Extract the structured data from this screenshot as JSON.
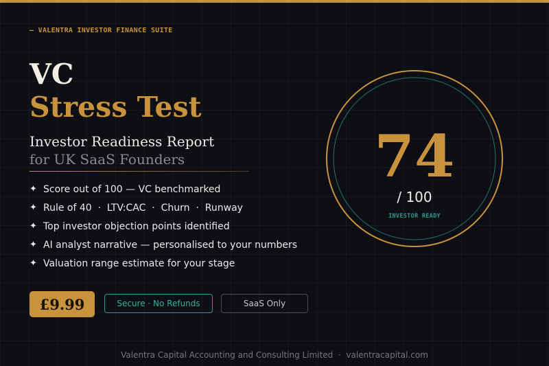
{
  "brand": {
    "eyebrow": "— VALENTRA INVESTOR FINANCE SUITE"
  },
  "hero": {
    "title_line1": "VC",
    "title_line2": "Stress Test",
    "subtitle_line1": "Investor Readiness Report",
    "subtitle_line2": "for UK SaaS Founders"
  },
  "features": [
    {
      "icon": "sparkle-icon",
      "text": "Score out of 100 — VC benchmarked"
    },
    {
      "icon": "sparkle-icon",
      "text": "Rule of 40  ·  LTV:CAC  ·  Churn  ·  Runway"
    },
    {
      "icon": "sparkle-icon",
      "text": "Top investor objection points identified"
    },
    {
      "icon": "sparkle-icon",
      "text": "AI analyst narrative — personalised to your numbers"
    },
    {
      "icon": "sparkle-icon",
      "text": "Valuation range estimate for your stage"
    }
  ],
  "cta": {
    "price": "£9.99",
    "secure_label": "Secure · No Refunds",
    "saas_label": "SaaS Only"
  },
  "score": {
    "value": "74",
    "out_of": "/ 100",
    "label": "INVESTOR READY"
  },
  "footer": {
    "text": "Valentra Capital Accounting and Consulting Limited  ·  valentracapital.com"
  },
  "colors": {
    "background": "#0e0e15",
    "accent_gold": "#c9923c",
    "accent_teal": "#2a9a8c",
    "text_light": "#f0ece4"
  }
}
